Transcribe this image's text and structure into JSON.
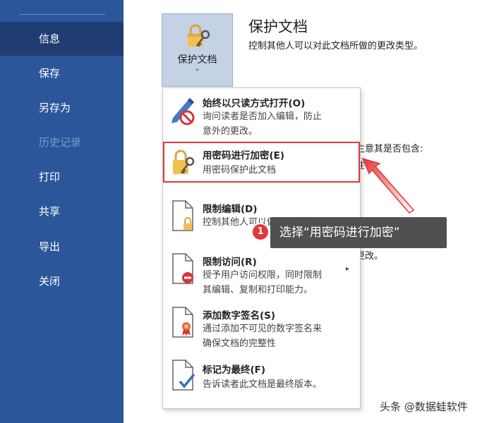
{
  "sidebar": {
    "items": [
      {
        "label": "信息",
        "state": "selected"
      },
      {
        "label": "保存",
        "state": "normal"
      },
      {
        "label": "另存为",
        "state": "normal"
      },
      {
        "label": "历史记录",
        "state": "disabled"
      },
      {
        "label": "打印",
        "state": "normal"
      },
      {
        "label": "共享",
        "state": "normal"
      },
      {
        "label": "导出",
        "state": "normal"
      },
      {
        "label": "关闭",
        "state": "normal"
      }
    ]
  },
  "protect": {
    "button_label": "保护文档",
    "chevron": "⌄",
    "title": "保护文档",
    "description": "控制其他人可以对此文档所做的更改类型。"
  },
  "background_fragments": {
    "inspect_partial": "主意其是否包含:",
    "inspect_partial2": "性名",
    "manage_partial": "更改。"
  },
  "menu": {
    "items": [
      {
        "icon": "pencil-no-edit-icon",
        "title": "始终以只读方式打开(O)",
        "description": "询问读者是否加入编辑，防止\n意外的更改。"
      },
      {
        "icon": "lock-key-icon",
        "title": "用密码进行加密(E)",
        "description": "用密码保护此文档"
      },
      {
        "icon": "doc-lock-icon",
        "title": "限制编辑(D)",
        "description": "控制其他人可以做的更改类型"
      },
      {
        "icon": "doc-restrict-icon",
        "title": "限制访问(R)",
        "description": "授予用户访问权限，同时限制\n其编辑、复制和打印能力。"
      },
      {
        "icon": "doc-ribbon-icon",
        "title": "添加数字签名(S)",
        "description": "通过添加不可见的数字签名来\n确保文档的完整性"
      },
      {
        "icon": "doc-check-icon",
        "title": "标记为最终(F)",
        "description": "告诉读者此文档是最终版本。"
      }
    ]
  },
  "callout": {
    "step_number": "1",
    "text": "选择“用密码进行加密”"
  },
  "watermark": "头条 @数据蛙软件",
  "colors": {
    "sidebar": "#2b579a",
    "sidebar_selected": "#1f3d73",
    "highlight": "#e0373a",
    "callout_bg": "#505050"
  }
}
